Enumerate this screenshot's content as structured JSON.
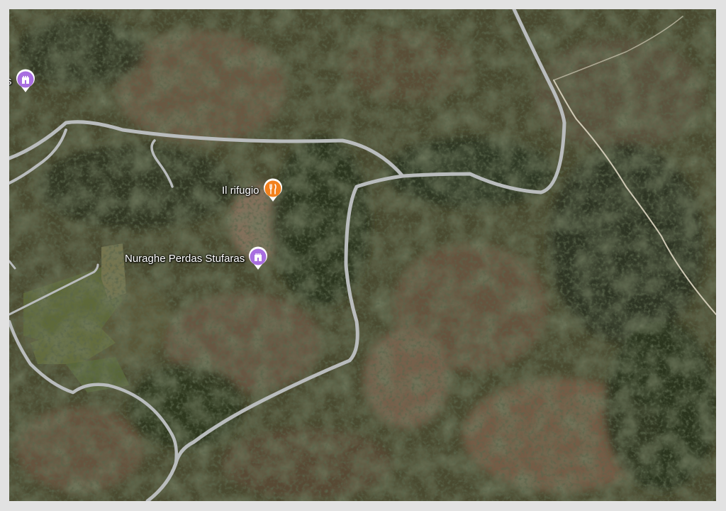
{
  "map": {
    "imagery": "satellite",
    "pois": [
      {
        "name": "Il rifugio",
        "icon": "fork-knife-icon",
        "color": "#f2811d"
      },
      {
        "name": "Nuraghe Perdas Stufaras",
        "icon": "castle-icon",
        "color": "#a86ee0"
      },
      {
        "name": "s",
        "icon": "castle-icon",
        "color": "#a86ee0"
      }
    ]
  }
}
